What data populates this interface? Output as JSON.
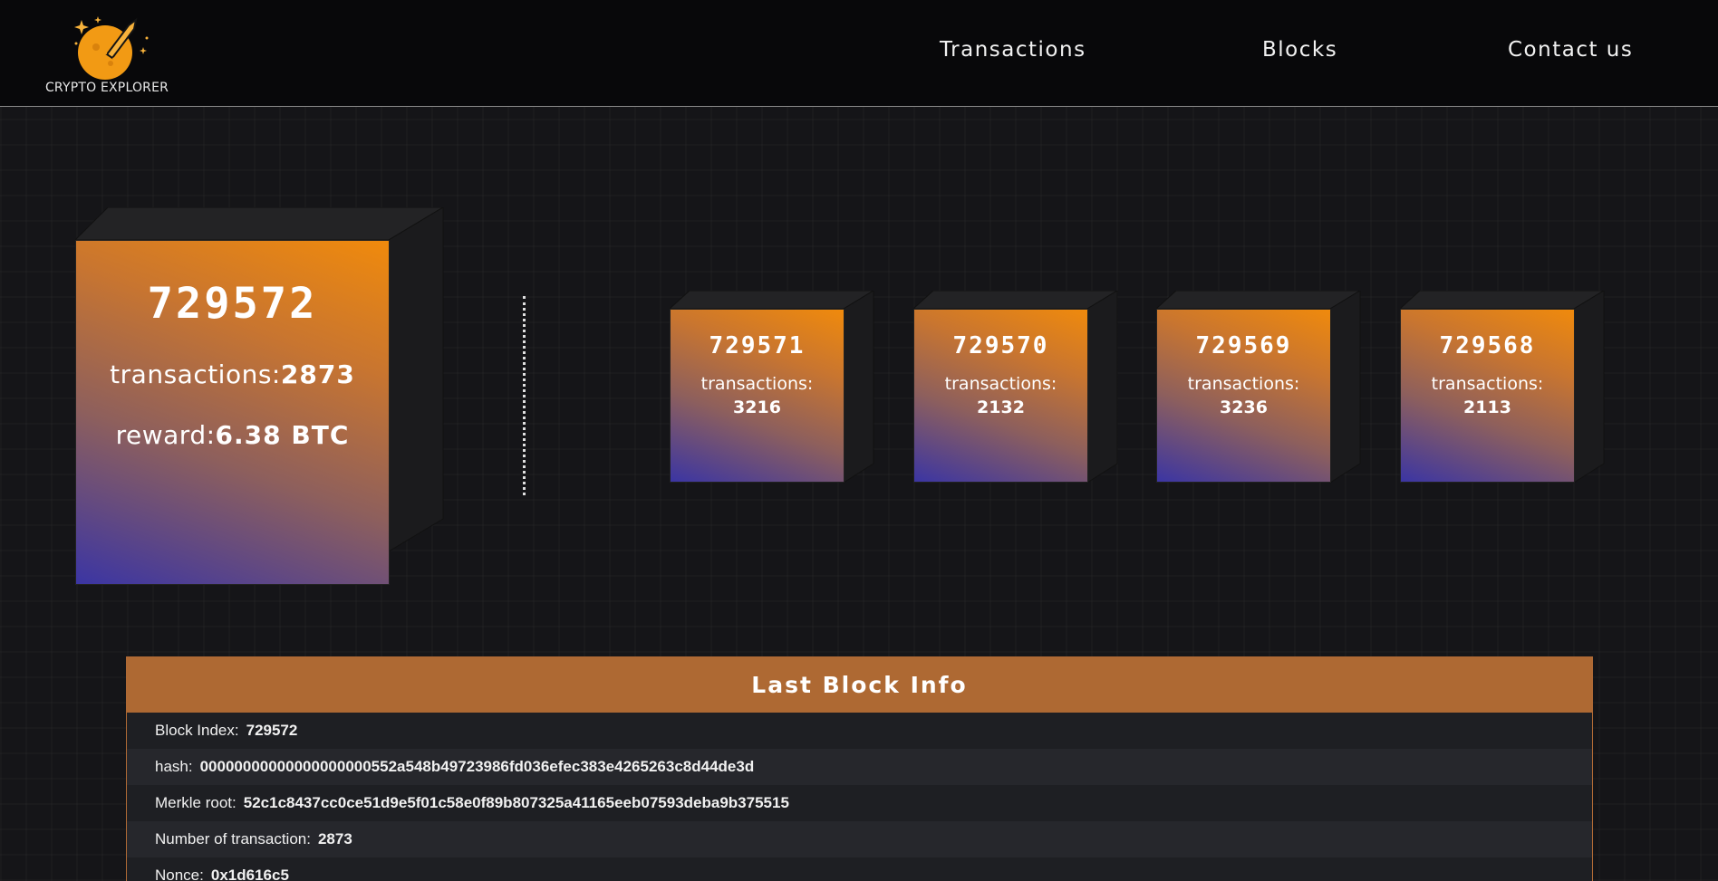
{
  "header": {
    "logo_text": "CRYPTO EXPLORER",
    "nav": [
      "Transactions",
      "Blocks",
      "Contact us"
    ]
  },
  "latest_block": {
    "index": "729572",
    "transactions_label": "transactions:",
    "transactions": "2873",
    "reward_label": "reward:",
    "reward": "6.38 BTC"
  },
  "previous_blocks": [
    {
      "index": "729571",
      "transactions_label": "transactions:",
      "transactions": "3216"
    },
    {
      "index": "729570",
      "transactions_label": "transactions:",
      "transactions": "2132"
    },
    {
      "index": "729569",
      "transactions_label": "transactions:",
      "transactions": "3236"
    },
    {
      "index": "729568",
      "transactions_label": "transactions:",
      "transactions": "2113"
    }
  ],
  "last_block_info": {
    "title": "Last Block Info",
    "rows": [
      {
        "label": "Block Index:",
        "value": "729572"
      },
      {
        "label": "hash:",
        "value": "00000000000000000000552a548b49723986fd036efec383e4265263c8d44de3d"
      },
      {
        "label": "Merkle root:",
        "value": "52c1c8437cc0ce51d9e5f01c58e0f89b807325a41165eeb07593deba9b375515"
      },
      {
        "label": "Number of transaction:",
        "value": "2873"
      },
      {
        "label": "Nonce:",
        "value": "0x1d616c5"
      }
    ]
  },
  "colors": {
    "accent": "#ae6933",
    "cube_top": "#f08a0c",
    "cube_bottom": "#3b35a3"
  }
}
